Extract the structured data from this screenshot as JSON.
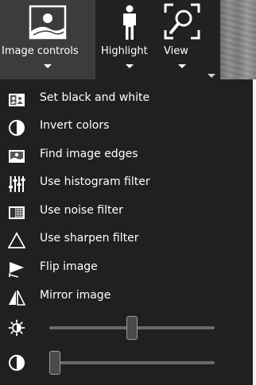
{
  "toolbar": {
    "image_controls_label": "Image controls",
    "highlight_label": "Highlight",
    "view_label": "View"
  },
  "menu": {
    "items": [
      {
        "label": "Set black and white",
        "icon": "black-white-icon"
      },
      {
        "label": "Invert colors",
        "icon": "invert-colors-icon"
      },
      {
        "label": "Find image edges",
        "icon": "image-edges-icon"
      },
      {
        "label": "Use histogram filter",
        "icon": "histogram-filter-icon"
      },
      {
        "label": "Use noise filter",
        "icon": "noise-filter-icon"
      },
      {
        "label": "Use sharpen filter",
        "icon": "sharpen-filter-icon"
      },
      {
        "label": "Flip image",
        "icon": "flip-image-icon"
      },
      {
        "label": "Mirror image",
        "icon": "mirror-image-icon"
      }
    ],
    "sliders": [
      {
        "icon": "brightness-icon",
        "value": 0.5
      },
      {
        "icon": "contrast-icon",
        "value": 0.0
      }
    ]
  },
  "colors": {
    "toolbar_bg": "#212121",
    "active_button_bg": "#3c3c3c",
    "menu_bg": "#202020"
  }
}
